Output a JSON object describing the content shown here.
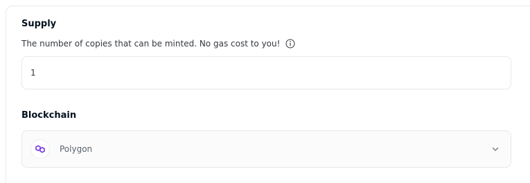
{
  "supply": {
    "label": "Supply",
    "description": "The number of copies that can be minted. No gas cost to you!",
    "info_icon": "info-circle-icon",
    "value": "1"
  },
  "blockchain": {
    "label": "Blockchain",
    "selected": "Polygon",
    "logo_icon": "polygon-logo-icon",
    "logo_color": "#8247e5",
    "dropdown_icon": "chevron-down-icon"
  }
}
